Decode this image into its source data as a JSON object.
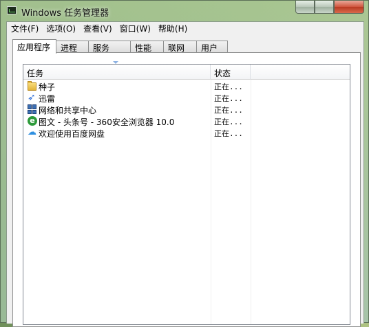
{
  "window": {
    "title": "Windows 任务管理器"
  },
  "menu": [
    "文件(F)",
    "选项(O)",
    "查看(V)",
    "窗口(W)",
    "帮助(H)"
  ],
  "tabs": [
    {
      "label": "应用程序",
      "active": true
    },
    {
      "label": "进程",
      "active": false
    },
    {
      "label": "服务",
      "active": false
    },
    {
      "label": "性能",
      "active": false
    },
    {
      "label": "联网",
      "active": false
    },
    {
      "label": "用户",
      "active": false
    }
  ],
  "list": {
    "columns": {
      "task": "任务",
      "status": "状态"
    },
    "rows": [
      {
        "name": "种子",
        "status": "正在...",
        "icon": "folder-icon"
      },
      {
        "name": "迅雷",
        "status": "正在...",
        "icon": "thunder-icon"
      },
      {
        "name": "网络和共享中心",
        "status": "正在...",
        "icon": "network-icon"
      },
      {
        "name": "图文 - 头条号 - 360安全浏览器 10.0",
        "status": "正在...",
        "icon": "browser-icon"
      },
      {
        "name": "欢迎使用百度网盘",
        "status": "正在...",
        "icon": "cloud-icon"
      }
    ]
  }
}
